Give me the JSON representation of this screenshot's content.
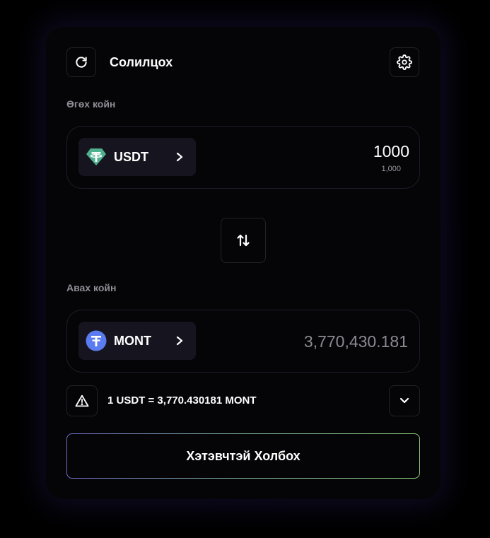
{
  "header": {
    "title": "Солилцох",
    "refresh_icon": "refresh-icon",
    "settings_icon": "gear-icon"
  },
  "give": {
    "label": "Өгөх койн",
    "token": "USDT",
    "token_icon": "tether-icon",
    "token_color": "#4fb08f",
    "amount": "1000",
    "amount_formatted": "1,000"
  },
  "swap": {
    "icon": "swap-arrows-icon"
  },
  "receive": {
    "label": "Авах койн",
    "token": "MONT",
    "token_icon": "mont-icon",
    "token_color": "#5b7cf0",
    "amount": "3,770,430.181"
  },
  "rate": {
    "text": "1 USDT = 3,770.430181 MONT",
    "icon": "warning-icon",
    "expand_icon": "chevron-down-icon"
  },
  "connect": {
    "label": "Хэтэвчтэй Холбох"
  }
}
